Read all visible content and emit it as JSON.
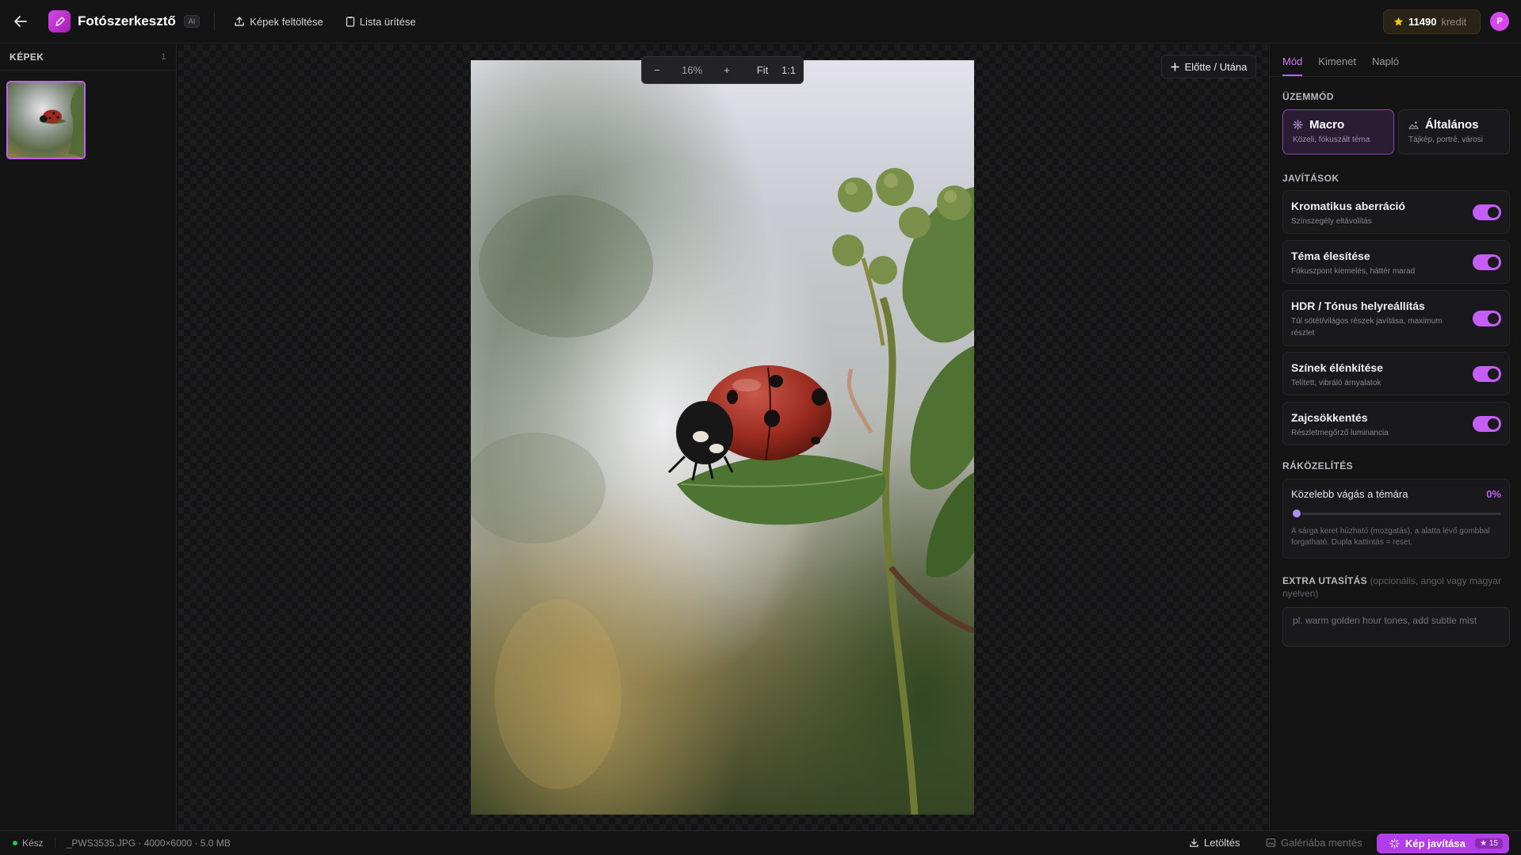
{
  "header": {
    "app_title": "Fotószerkesztő",
    "ai_badge": "AI",
    "upload_label": "Képek feltöltése",
    "clear_label": "Lista ürítése",
    "credits_value": "11490",
    "credits_label": "kredit",
    "avatar_letter": "P"
  },
  "left_panel": {
    "title": "KÉPEK",
    "count": "1"
  },
  "canvas": {
    "zoom_minus": "−",
    "zoom_level": "16%",
    "zoom_plus": "+",
    "fit_label": "Fit",
    "one_to_one_label": "1:1",
    "before_after_label": "Előtte / Utána"
  },
  "right_panel": {
    "tabs": [
      "Mód",
      "Kimenet",
      "Napló"
    ],
    "mode_section": "ÜZEMMÓD",
    "modes": [
      {
        "title": "Macro",
        "subtitle": "Közeli, fókuszált téma"
      },
      {
        "title": "Általános",
        "subtitle": "Tájkép, portré, városi"
      }
    ],
    "fixes_section": "JAVÍTÁSOK",
    "fixes": [
      {
        "title": "Kromatikus aberráció",
        "subtitle": "Színszegély eltávolítás"
      },
      {
        "title": "Téma élesítése",
        "subtitle": "Fókuszpont kiemelés, háttér marad"
      },
      {
        "title": "HDR / Tónus helyreállítás",
        "subtitle": "Túl sötét/világos részek javítása, maximum részlet"
      },
      {
        "title": "Színek élénkítése",
        "subtitle": "Telített, vibráló árnyalatok"
      },
      {
        "title": "Zajcsökkentés",
        "subtitle": "Részletmegőrző luminancia"
      }
    ],
    "zoom_section": "RÁKÖZELÍTÉS",
    "zoom_label": "Közelebb vágás a témára",
    "zoom_value": "0%",
    "zoom_value_fraction": 0,
    "zoom_hint": "A sárga keret húzható (mozgatás), a alatta lévő gombbal forgatható. Dupla kattintás = reset.",
    "extra_title": "EXTRA UTASÍTÁS",
    "extra_optional": "(opcionális, angol vagy magyar nyelven)",
    "extra_placeholder": "pl. warm golden hour tones, add subtle mist"
  },
  "status_bar": {
    "status": "Kész",
    "file_info": "_PWS3535.JPG · 4000×6000 · 5.0 MB",
    "download_label": "Letöltés",
    "gallery_label": "Galériába mentés",
    "improve_label": "Kép javítása",
    "cost": "★ 15"
  },
  "colors": {
    "accent": "#c35ff5",
    "credits_star": "#f5c518",
    "status_ok": "#22c55e"
  }
}
